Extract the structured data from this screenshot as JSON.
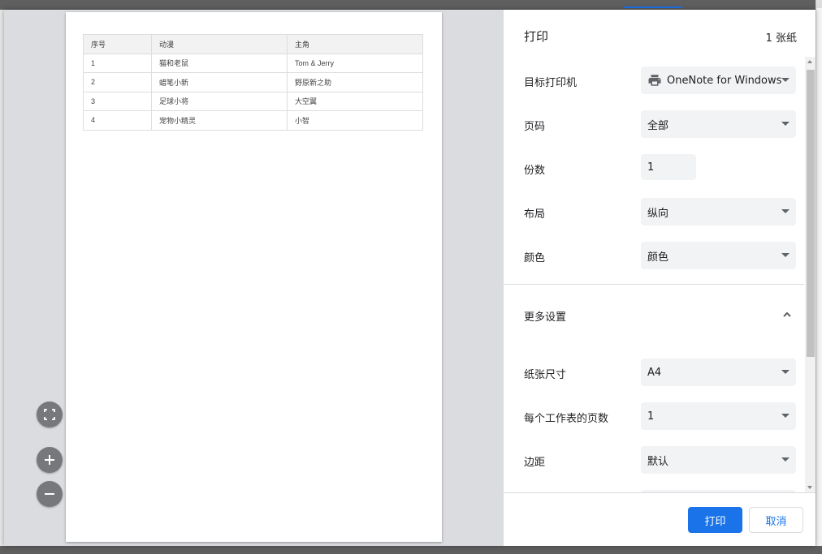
{
  "dialog": {
    "title": "打印",
    "sheet_count": "1 张纸"
  },
  "preview": {
    "table": {
      "headers": [
        "序号",
        "动漫",
        "主角"
      ],
      "rows": [
        [
          "1",
          "猫和老鼠",
          "Tom & Jerry"
        ],
        [
          "2",
          "蜡笔小新",
          "野原新之助"
        ],
        [
          "3",
          "足球小将",
          "大空翼"
        ],
        [
          "4",
          "宠物小精灵",
          "小智"
        ]
      ]
    },
    "controls": {
      "fit_icon": "fit-to-page-icon",
      "zoom_in_icon": "zoom-in-icon",
      "zoom_out_icon": "zoom-out-icon"
    }
  },
  "settings": {
    "destination": {
      "label": "目标打印机",
      "value": "OneNote for Windows",
      "icon": "printer-icon"
    },
    "pages": {
      "label": "页码",
      "value": "全部"
    },
    "copies": {
      "label": "份数",
      "value": "1"
    },
    "layout": {
      "label": "布局",
      "value": "纵向"
    },
    "color": {
      "label": "颜色",
      "value": "颜色"
    },
    "more_settings": {
      "label": "更多设置",
      "icon": "chevron-up-icon"
    },
    "paper_size": {
      "label": "纸张尺寸",
      "value": "A4"
    },
    "pages_per_sheet": {
      "label": "每个工作表的页数",
      "value": "1"
    },
    "margins": {
      "label": "边距",
      "value": "默认"
    }
  },
  "footer": {
    "print_label": "打印",
    "cancel_label": "取消"
  },
  "colors": {
    "accent": "#1a73e8",
    "select_bg": "#f1f3f4",
    "preview_bg": "#dadce0"
  }
}
